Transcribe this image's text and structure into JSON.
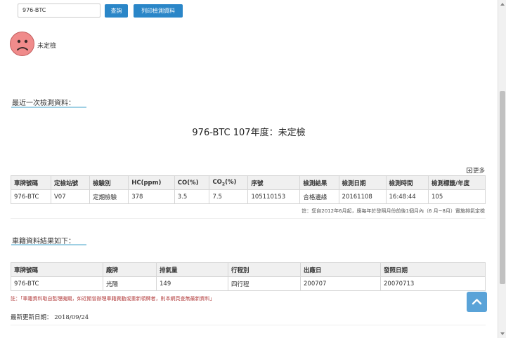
{
  "search": {
    "value": "976-BTC"
  },
  "buttons": {
    "query": "查詢",
    "print": "列印檢測資料"
  },
  "status": {
    "text": "未定檢"
  },
  "latest": {
    "heading": "最近一次檢測資料：",
    "vehicle_title": "976-BTC 107年度：未定檢",
    "more": "更多",
    "columns": [
      "車牌號碼",
      "定檢站號",
      "檢驗別",
      "HC(ppm)",
      "CO(%)",
      "CO",
      "序號",
      "檢測結果",
      "檢測日期",
      "檢測時間",
      "檢測標籤/年度"
    ],
    "co2": {
      "base": "CO",
      "sub": "2",
      "unit": "(%)"
    },
    "row": [
      "976-BTC",
      "V07",
      "定期檢驗",
      "378",
      "3.5",
      "7.5",
      "105110153",
      "合格邊緣",
      "20161108",
      "16:48:44",
      "105"
    ],
    "note": "註：您自2012年6月起，應每年於發照月份前後1個月內（6 月~8月）實施排氣定檢"
  },
  "registry": {
    "heading": "車籍資料結果如下：",
    "columns": [
      "車牌號碼",
      "廠牌",
      "排氣量",
      "行程別",
      "出廠日",
      "發照日期"
    ],
    "row": [
      "976-BTC",
      "光陽",
      "149",
      "四行程",
      "200707",
      "20070713"
    ],
    "note": "註：「車籍資料取自監理機關，如近期曾辦理車籍異動或重新領牌者，則本網頁查無最新資料」"
  },
  "updated": "最新更新日期： 2018/09/24",
  "colors": {
    "accent": "#2a86c8",
    "underline": "#9fd0e4",
    "face": "#f08b8b",
    "note_red": "#b23b3b",
    "back_to_top": "#5aa3d8"
  },
  "icons": {
    "status": "sad-face-icon",
    "more": "plus-square-icon",
    "back_to_top": "chevron-up-icon"
  }
}
